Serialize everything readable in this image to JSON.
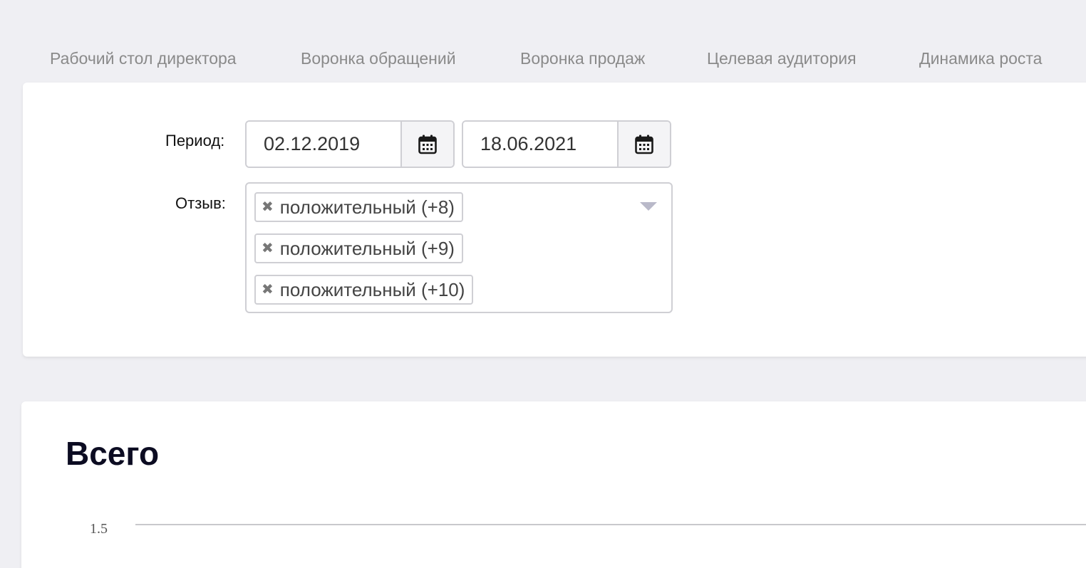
{
  "tabs": [
    {
      "label": "Рабочий стол директора"
    },
    {
      "label": "Воронка обращений"
    },
    {
      "label": "Воронка продаж"
    },
    {
      "label": "Целевая аудитория"
    },
    {
      "label": "Динамика роста"
    }
  ],
  "filters": {
    "period_label": "Период:",
    "date_from": "02.12.2019",
    "date_to": "18.06.2021",
    "calendar_icon": "calendar-icon",
    "review_label": "Отзыв:",
    "selected_reviews": [
      {
        "label": "положительный (+8)"
      },
      {
        "label": "положительный (+9)"
      },
      {
        "label": "положительный (+10)"
      }
    ],
    "remove_glyph": "✖"
  },
  "chart": {
    "title": "Всего"
  },
  "chart_data": {
    "type": "line",
    "title": "Всего",
    "y_ticks": [
      "1.5"
    ],
    "grid": true
  }
}
